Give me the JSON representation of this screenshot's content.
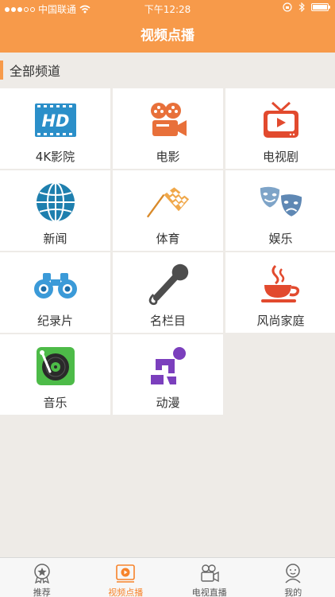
{
  "status_bar": {
    "carrier": "中国联通",
    "time": "下午12:28"
  },
  "nav": {
    "title": "视频点播"
  },
  "section": {
    "title": "全部频道"
  },
  "channels": [
    {
      "label": "4K影院",
      "icon": "hd-icon"
    },
    {
      "label": "电影",
      "icon": "film-projector-icon"
    },
    {
      "label": "电视剧",
      "icon": "tv-icon"
    },
    {
      "label": "新闻",
      "icon": "globe-icon"
    },
    {
      "label": "体育",
      "icon": "checkered-flag-icon"
    },
    {
      "label": "娱乐",
      "icon": "theater-masks-icon"
    },
    {
      "label": "纪录片",
      "icon": "binoculars-icon"
    },
    {
      "label": "名栏目",
      "icon": "microphone-icon"
    },
    {
      "label": "风尚家庭",
      "icon": "coffee-cup-icon"
    },
    {
      "label": "音乐",
      "icon": "record-player-icon"
    },
    {
      "label": "动漫",
      "icon": "anime-figure-icon"
    }
  ],
  "tabbar": {
    "tabs": [
      {
        "label": "推荐",
        "icon": "badge-icon",
        "active": false
      },
      {
        "label": "视频点播",
        "icon": "video-play-icon",
        "active": true
      },
      {
        "label": "电视直播",
        "icon": "video-camera-icon",
        "active": false
      },
      {
        "label": "我的",
        "icon": "user-icon",
        "active": false
      }
    ]
  },
  "colors": {
    "accent": "#f79a4a",
    "active_tab": "#f7832a",
    "background": "#eeebe7"
  }
}
